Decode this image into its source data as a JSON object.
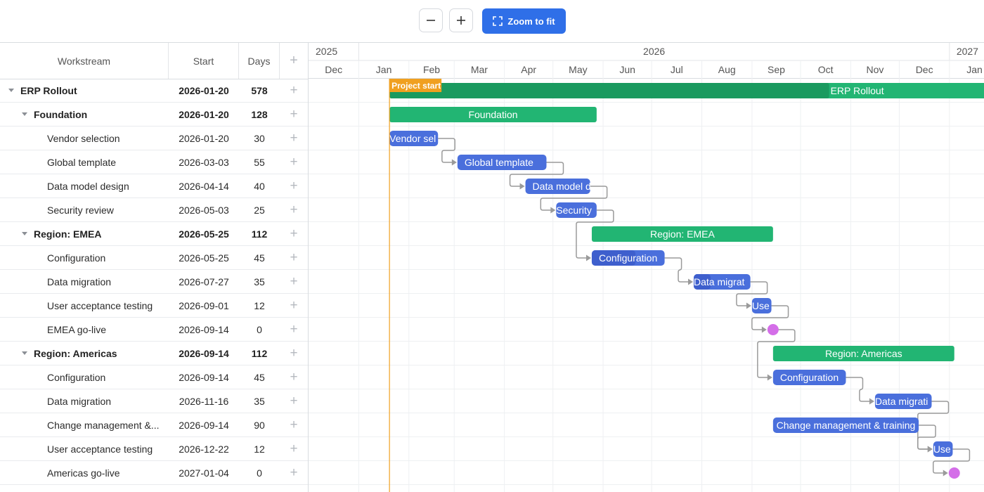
{
  "toolbar": {
    "zoom_out_label": "−",
    "zoom_in_label": "+",
    "zoom_fit_label": "Zoom to fit"
  },
  "grid": {
    "columns": {
      "workstream": "Workstream",
      "start": "Start",
      "days": "Days",
      "add": "+"
    },
    "rows": [
      {
        "name": "ERP Rollout",
        "start": "2026-01-20",
        "days": "578",
        "level": 0,
        "summary": true,
        "expanded": true
      },
      {
        "name": "Foundation",
        "start": "2026-01-20",
        "days": "128",
        "level": 1,
        "summary": true,
        "expanded": true
      },
      {
        "name": "Vendor selection",
        "start": "2026-01-20",
        "days": "30",
        "level": 2
      },
      {
        "name": "Global template",
        "start": "2026-03-03",
        "days": "55",
        "level": 2
      },
      {
        "name": "Data model design",
        "start": "2026-04-14",
        "days": "40",
        "level": 2
      },
      {
        "name": "Security review",
        "start": "2026-05-03",
        "days": "25",
        "level": 2
      },
      {
        "name": "Region: EMEA",
        "start": "2026-05-25",
        "days": "112",
        "level": 1,
        "summary": true,
        "expanded": true
      },
      {
        "name": "Configuration",
        "start": "2026-05-25",
        "days": "45",
        "level": 2
      },
      {
        "name": "Data migration",
        "start": "2026-07-27",
        "days": "35",
        "level": 2
      },
      {
        "name": "User acceptance testing",
        "start": "2026-09-01",
        "days": "12",
        "level": 2
      },
      {
        "name": "EMEA go-live",
        "start": "2026-09-14",
        "days": "0",
        "level": 2
      },
      {
        "name": "Region: Americas",
        "start": "2026-09-14",
        "days": "112",
        "level": 1,
        "summary": true,
        "expanded": true
      },
      {
        "name": "Configuration",
        "start": "2026-09-14",
        "days": "45",
        "level": 2
      },
      {
        "name": "Data migration",
        "start": "2026-11-16",
        "days": "35",
        "level": 2
      },
      {
        "name": "Change management &...",
        "start": "2026-09-14",
        "days": "90",
        "level": 2
      },
      {
        "name": "User acceptance testing",
        "start": "2026-12-22",
        "days": "12",
        "level": 2
      },
      {
        "name": "Americas go-live",
        "start": "2027-01-04",
        "days": "0",
        "level": 2
      }
    ]
  },
  "timeline": {
    "years": [
      "2025",
      "2026",
      "2027"
    ],
    "months": [
      "Dec",
      "Jan",
      "Feb",
      "Mar",
      "Apr",
      "May",
      "Jun",
      "Jul",
      "Aug",
      "Sep",
      "Oct",
      "Nov",
      "Dec",
      "Jan"
    ],
    "marker": {
      "label": "Project start",
      "date": "2026-01-20",
      "color": "#f0a020"
    },
    "colors": {
      "task": "#4a6fdc",
      "summary": "#22b573",
      "summary_progress": "#1a9a5f",
      "milestone": "#d46ee8",
      "link": "#9a9a9a"
    },
    "bars": [
      {
        "label": "ERP Rollout",
        "type": "summary",
        "progress": 0.47
      },
      {
        "label": "Foundation",
        "type": "summary",
        "progress": 0
      },
      {
        "label": "Vendor sel",
        "type": "task",
        "progress": 0
      },
      {
        "label": "Global template",
        "type": "task",
        "progress": 0
      },
      {
        "label": "Data model de",
        "type": "task",
        "progress": 0
      },
      {
        "label": "Security",
        "type": "task",
        "progress": 0
      },
      {
        "label": "Region: EMEA",
        "type": "summary",
        "progress": 0
      },
      {
        "label": "Configuration",
        "type": "task",
        "progress": 0.6
      },
      {
        "label": "Data migrat",
        "type": "task",
        "progress": 0.3
      },
      {
        "label": "Use",
        "type": "task",
        "progress": 0
      },
      {
        "label": "",
        "type": "milestone"
      },
      {
        "label": "Region: Americas",
        "type": "summary",
        "progress": 0
      },
      {
        "label": "Configuration",
        "type": "task",
        "progress": 0
      },
      {
        "label": "Data migrati",
        "type": "task",
        "progress": 0
      },
      {
        "label": "Change management & training",
        "type": "task",
        "progress": 0
      },
      {
        "label": "Use",
        "type": "task",
        "progress": 0
      },
      {
        "label": "",
        "type": "milestone"
      }
    ]
  }
}
